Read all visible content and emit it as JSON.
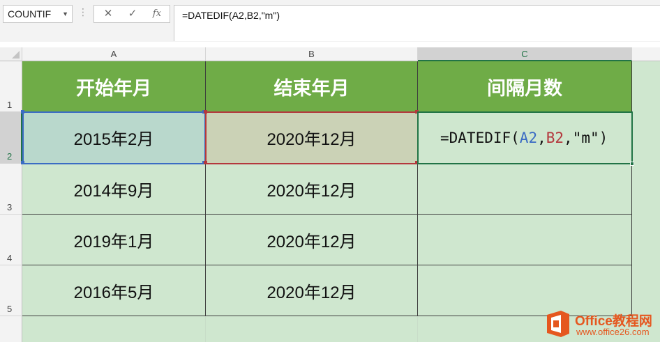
{
  "name_box": {
    "value": "COUNTIF"
  },
  "formula_bar": {
    "cancel_icon": "✕",
    "enter_icon": "✓",
    "fx_label": "fx",
    "formula": "=DATEDIF(A2,B2,\"m\")"
  },
  "columns": [
    "A",
    "B",
    "C"
  ],
  "rows": [
    "1",
    "2",
    "3",
    "4",
    "5"
  ],
  "headers": {
    "a": "开始年月",
    "b": "结束年月",
    "c": "间隔月数"
  },
  "data": [
    {
      "a": "2015年2月",
      "b": "2020年12月"
    },
    {
      "a": "2014年9月",
      "b": "2020年12月"
    },
    {
      "a": "2019年1月",
      "b": "2020年12月"
    },
    {
      "a": "2016年5月",
      "b": "2020年12月"
    }
  ],
  "edit_cell": {
    "prefix": "=DATEDIF(",
    "ref1": "A2",
    "sep1": ",",
    "ref2": "B2",
    "rest": ",\"m\")"
  },
  "colors": {
    "header_fill": "#6fac47",
    "cell_fill": "#cfe7cf",
    "ref_a": "#3b6cc4",
    "ref_b": "#b4383d",
    "excel_green": "#217346"
  },
  "watermark": {
    "brand": "Office教程网",
    "url": "www.office26.com"
  }
}
